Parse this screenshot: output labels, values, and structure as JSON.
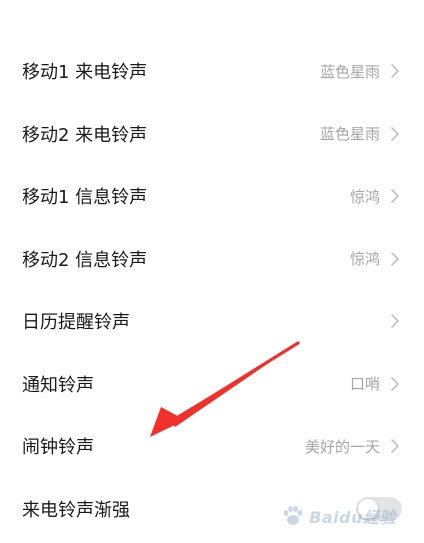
{
  "settings": {
    "items": [
      {
        "label": "移动1 来电铃声",
        "value": "蓝色星雨"
      },
      {
        "label": "移动2 来电铃声",
        "value": "蓝色星雨"
      },
      {
        "label": "移动1 信息铃声",
        "value": "惊鸿"
      },
      {
        "label": "移动2 信息铃声",
        "value": "惊鸿"
      },
      {
        "label": "日历提醒铃声",
        "value": ""
      },
      {
        "label": "通知铃声",
        "value": "口哨"
      },
      {
        "label": "闹钟铃声",
        "value": "美好的一天"
      },
      {
        "label": "来电铃声渐强",
        "toggle": "off"
      }
    ]
  },
  "annotation": {
    "arrow_color": "#f0302a",
    "target": "闹钟铃声"
  },
  "icons": {
    "row_chevron": "chevron-right-icon",
    "watermark": "baidu-paw-icon"
  },
  "colors": {
    "label": "#1a1a1a",
    "value": "#a6a6a6",
    "chevron": "#c0c0c0",
    "background": "#ffffff"
  }
}
